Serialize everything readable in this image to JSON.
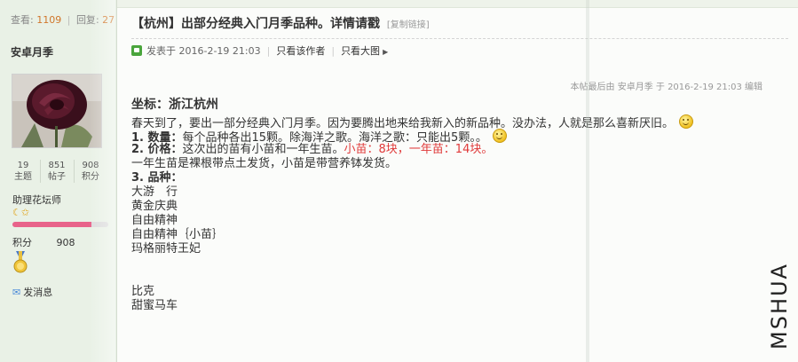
{
  "thread_stats": {
    "views_label": "查看",
    "views_value": "1109",
    "replies_label": "回复",
    "replies_value": "27"
  },
  "author": {
    "username": "安卓月季",
    "stats": [
      {
        "value": "19",
        "label": "主题"
      },
      {
        "value": "851",
        "label": "帖子"
      },
      {
        "value": "908",
        "label": "积分"
      }
    ],
    "group": "助理花坛师",
    "level_progress": 0.82,
    "points_label": "积分",
    "points_value": "908",
    "send_message": "发消息"
  },
  "post": {
    "title": "【杭州】出部分经典入门月季品种。详情请戳",
    "copy_link": "[复制链接]",
    "posted_at": "发表于 2016-2-19 21:03",
    "only_author": "只看该作者",
    "only_image": "只看大图",
    "edit_note": "本帖最后由 安卓月季 于 2016-2-19 21:03 编辑",
    "coords": "坐标：浙江杭州",
    "intro": "春天到了，要出一部分经典入门月季。因为要腾出地来给我新入的新品种。没办法，人就是那么喜新厌旧。",
    "qty_label": "1. 数量：",
    "qty_text": "每个品种各出15颗。除海洋之歌。海洋之歌：只能出5颗。。",
    "price_label": "2. 价格：",
    "price_text": "这次出的苗有小苗和一年生苗。",
    "price_red": "小苗：8块，一年苗：14块。",
    "shipping": "一年生苗是裸根带点土发货，小苗是带营养钵发货。",
    "variety_label": "3. 品种：",
    "varieties": [
      "大游　行",
      "黄金庆典",
      "自由精神",
      "自由精神｛小苗｝",
      "玛格丽特王妃"
    ],
    "varieties_more": [
      "比克",
      "甜蜜马车"
    ]
  },
  "watermark": "MSHUA",
  "colors": {
    "accent_orange": "#d0762a",
    "price_red": "#e03a3a",
    "sidebar_bg": "#e9f1e6"
  }
}
